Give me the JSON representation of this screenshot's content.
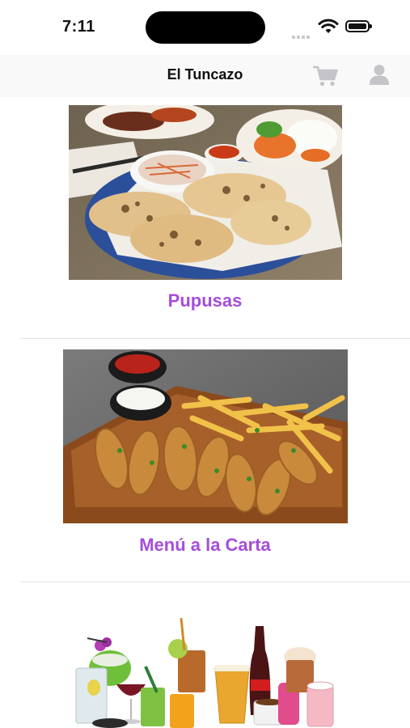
{
  "status_bar": {
    "time": "7:11"
  },
  "nav": {
    "title": "El Tuncazo",
    "cart_icon": "cart-icon",
    "account_icon": "person-icon"
  },
  "colors": {
    "accent": "#a54ddc",
    "icon_gray": "#c4c4c8"
  },
  "menu": {
    "items": [
      {
        "label": "Pupusas",
        "image": "pupusas-photo"
      },
      {
        "label": "Menú a la Carta",
        "image": "chicken-tenders-fries-photo"
      },
      {
        "label": "",
        "image": "drinks-photo"
      }
    ]
  }
}
